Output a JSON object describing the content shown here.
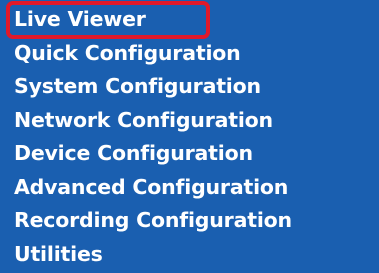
{
  "menu": {
    "items": [
      {
        "label": "Live Viewer"
      },
      {
        "label": "Quick Configuration"
      },
      {
        "label": "System Configuration"
      },
      {
        "label": "Network Configuration"
      },
      {
        "label": "Device Configuration"
      },
      {
        "label": "Advanced Configuration"
      },
      {
        "label": "Recording Configuration"
      },
      {
        "label": "Utilities"
      }
    ]
  },
  "colors": {
    "background": "#1a5fb0",
    "text": "#ffffff",
    "highlight": "#e0192a"
  }
}
